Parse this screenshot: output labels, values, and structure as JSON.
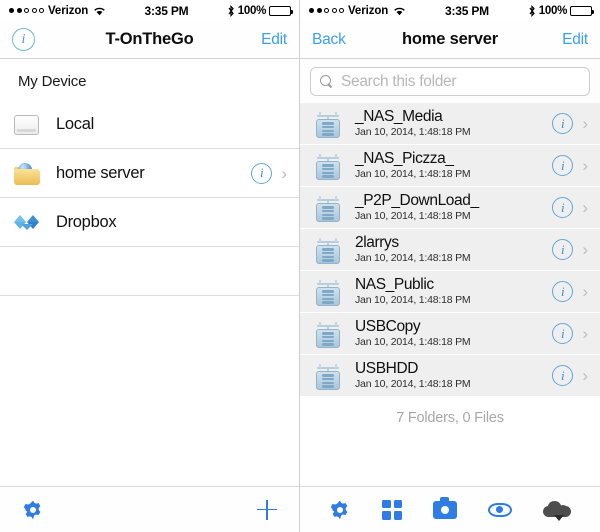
{
  "left": {
    "status": {
      "carrier": "Verizon",
      "signal_filled": 2,
      "signal_total": 5,
      "time": "3:35 PM",
      "battery_pct": "100%"
    },
    "nav": {
      "title": "T-OnTheGo",
      "info_label": "i",
      "edit_label": "Edit"
    },
    "section_header": "My Device",
    "rows": [
      {
        "label": "Local",
        "icon": "hard-drive-icon",
        "has_info": false,
        "has_chevron": false
      },
      {
        "label": "home server",
        "icon": "network-folder-icon",
        "has_info": true,
        "has_chevron": true,
        "info_label": "i",
        "chevron": "›"
      },
      {
        "label": "Dropbox",
        "icon": "dropbox-icon",
        "has_info": false,
        "has_chevron": false
      }
    ],
    "toolbar": {
      "settings_label": "settings",
      "add_label": "add"
    }
  },
  "right": {
    "status": {
      "carrier": "Verizon",
      "signal_filled": 2,
      "signal_total": 5,
      "time": "3:35 PM",
      "battery_pct": "100%"
    },
    "nav": {
      "back_label": "Back",
      "title": "home server",
      "edit_label": "Edit"
    },
    "search": {
      "placeholder": "Search this folder",
      "value": ""
    },
    "files": [
      {
        "name": "_NAS_Media",
        "date": "Jan 10, 2014, 1:48:18 PM",
        "info_label": "i",
        "chevron": "›"
      },
      {
        "name": "_NAS_Piczza_",
        "date": "Jan 10, 2014, 1:48:18 PM",
        "info_label": "i",
        "chevron": "›"
      },
      {
        "name": "_P2P_DownLoad_",
        "date": "Jan 10, 2014, 1:48:18 PM",
        "info_label": "i",
        "chevron": "›"
      },
      {
        "name": "2larrys",
        "date": "Jan 10, 2014, 1:48:18 PM",
        "info_label": "i",
        "chevron": "›"
      },
      {
        "name": "NAS_Public",
        "date": "Jan 10, 2014, 1:48:18 PM",
        "info_label": "i",
        "chevron": "›"
      },
      {
        "name": "USBCopy",
        "date": "Jan 10, 2014, 1:48:18 PM",
        "info_label": "i",
        "chevron": "›"
      },
      {
        "name": "USBHDD",
        "date": "Jan 10, 2014, 1:48:18 PM",
        "info_label": "i",
        "chevron": "›"
      }
    ],
    "count_line": "7 Folders, 0 Files",
    "toolbar": {
      "settings_label": "settings",
      "grid_label": "grid view",
      "camera_label": "camera",
      "preview_label": "preview",
      "upload_label": "upload to cloud"
    }
  },
  "colors": {
    "accent_blue": "#2e7ce4",
    "link_blue": "#3b9ff0",
    "row_gray": "#efefef",
    "muted_gray": "#a8a8a8"
  }
}
